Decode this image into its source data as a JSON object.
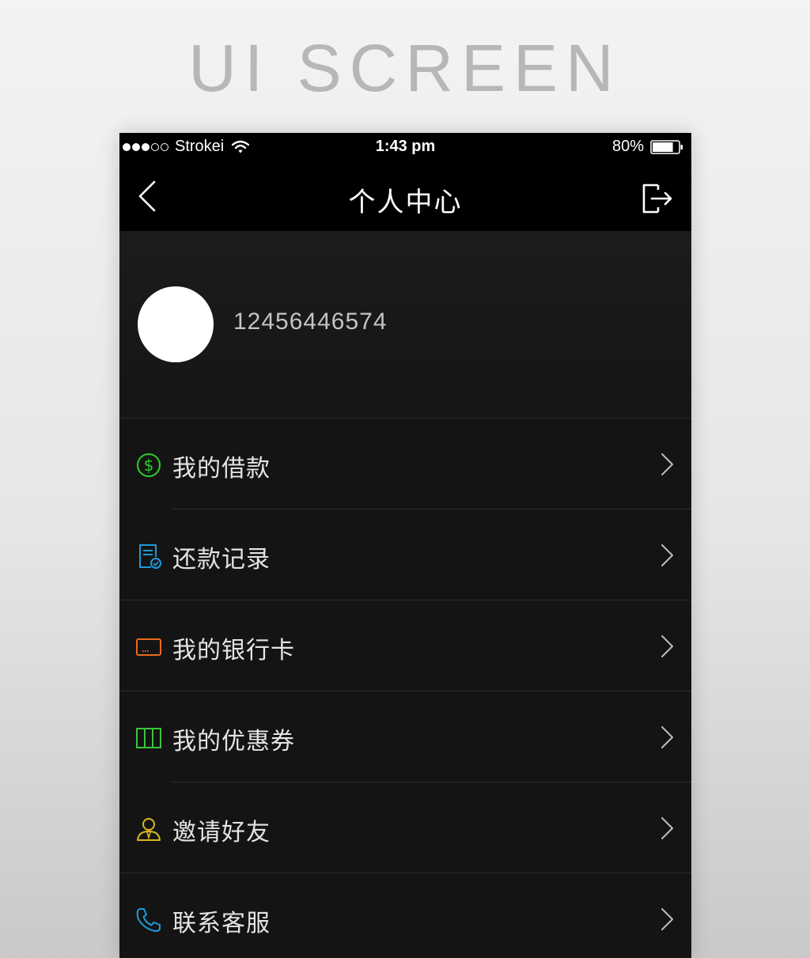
{
  "page_heading": "UI SCREEN",
  "status_bar": {
    "carrier": "Strokei",
    "time": "1:43 pm",
    "battery_percent": "80%",
    "battery_level": 0.8,
    "signal_bars_filled": 3,
    "signal_bars_total": 5
  },
  "nav": {
    "title": "个人中心",
    "back_icon": "chevron-left-icon",
    "logout_icon": "logout-icon"
  },
  "profile": {
    "account_number": "12456446574"
  },
  "menu": {
    "items": [
      {
        "label": "我的借款",
        "icon": "dollar-circle-icon",
        "color": "#2bd02b"
      },
      {
        "label": "还款记录",
        "icon": "repayment-record-icon",
        "color": "#1e9bd8"
      },
      {
        "label": "我的银行卡",
        "icon": "bank-card-icon",
        "color": "#e86a1c"
      },
      {
        "label": "我的优惠券",
        "icon": "coupon-icon",
        "color": "#3cc43c"
      },
      {
        "label": "邀请好友",
        "icon": "invite-friend-icon",
        "color": "#d8b81e"
      },
      {
        "label": "联系客服",
        "icon": "phone-icon",
        "color": "#1e9bd8"
      }
    ]
  }
}
